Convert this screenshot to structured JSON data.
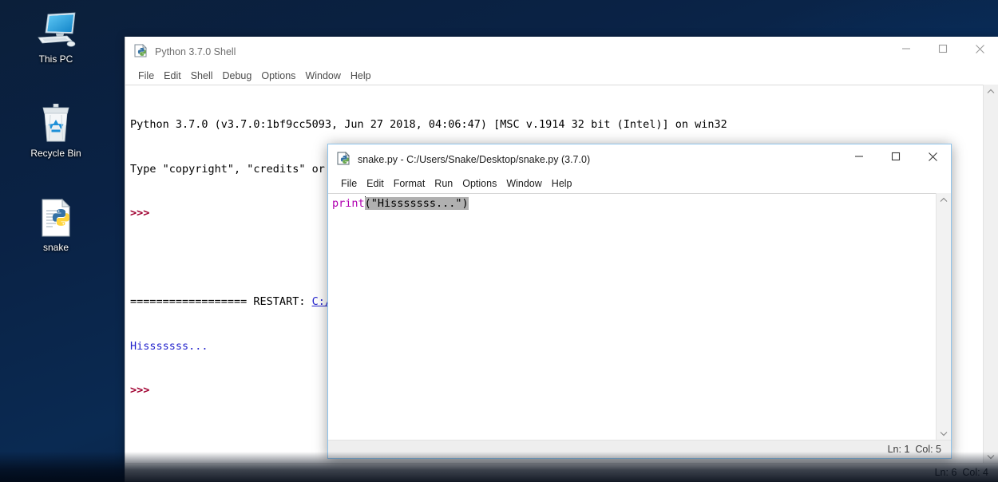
{
  "desktop": {
    "background_colors": {
      "dark": "#0a2245",
      "accent": "#008ceb"
    },
    "icons": [
      {
        "name": "this-pc",
        "label": "This PC",
        "icon": "monitor-icon"
      },
      {
        "name": "recycle-bin",
        "label": "Recycle Bin",
        "icon": "recycle-bin-icon"
      },
      {
        "name": "snake",
        "label": "snake",
        "icon": "python-file-icon"
      }
    ]
  },
  "shell_window": {
    "title": "Python 3.7.0 Shell",
    "icon": "python-idle-icon",
    "menu": [
      "File",
      "Edit",
      "Shell",
      "Debug",
      "Options",
      "Window",
      "Help"
    ],
    "controls": {
      "minimize": "minimize-icon",
      "maximize": "maximize-icon",
      "close": "close-icon"
    },
    "lines": [
      {
        "id": "l1",
        "text": "Python 3.7.0 (v3.7.0:1bf9cc5093, Jun 27 2018, 04:06:47) [MSC v.1914 32 bit (Intel)] on win32",
        "style": "plain"
      },
      {
        "id": "l2",
        "text": "Type \"copyright\", \"credits\" or \"license()\" for more information.",
        "style": "plain"
      },
      {
        "id": "l3",
        "text": ">>>",
        "style": "prompt"
      },
      {
        "id": "l4",
        "text": "",
        "style": "plain"
      },
      {
        "id": "l5_pre",
        "text": "================== RESTART: ",
        "style": "plain"
      },
      {
        "id": "l5_path",
        "text": "C:/Users/Snake/Desktop/snake.py",
        "style": "path"
      },
      {
        "id": "l5_post",
        "text": " ==================",
        "style": "plain"
      },
      {
        "id": "l6",
        "text": "Hisssssss...",
        "style": "output"
      },
      {
        "id": "l7",
        "text": ">>>",
        "style": "prompt"
      }
    ],
    "status": {
      "line_label": "Ln:",
      "line_value": "6",
      "col_label": "Col:",
      "col_value": "4",
      "text": "Ln: 6  Col: 4"
    },
    "scrollbar": {
      "up": "chevron-up-icon",
      "down": "chevron-down-icon"
    }
  },
  "editor_window": {
    "title": "snake.py - C:/Users/Snake/Desktop/snake.py (3.7.0)",
    "icon": "python-idle-icon",
    "menu": [
      "File",
      "Edit",
      "Format",
      "Run",
      "Options",
      "Window",
      "Help"
    ],
    "controls": {
      "minimize": "minimize-icon",
      "maximize": "maximize-icon",
      "close": "close-icon"
    },
    "code": {
      "keyword": "print",
      "selected": "(\"Hisssssss...\")",
      "full_line": "print(\"Hisssssss...\")"
    },
    "status": {
      "line_label": "Ln:",
      "line_value": "1",
      "col_label": "Col:",
      "col_value": "5",
      "text": "Ln: 1  Col: 5"
    },
    "scrollbar": {
      "up": "chevron-up-icon",
      "down": "chevron-down-icon"
    }
  }
}
